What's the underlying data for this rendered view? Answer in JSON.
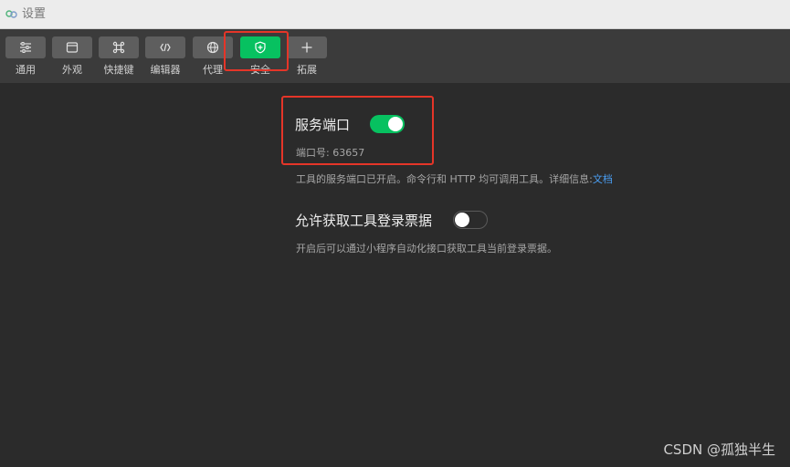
{
  "window": {
    "title": "设置"
  },
  "toolbar": {
    "items": [
      {
        "label": "通用",
        "icon": "sliders-icon",
        "active": false
      },
      {
        "label": "外观",
        "icon": "window-icon",
        "active": false
      },
      {
        "label": "快捷键",
        "icon": "command-key-icon",
        "active": false
      },
      {
        "label": "编辑器",
        "icon": "code-brackets-icon",
        "active": false
      },
      {
        "label": "代理",
        "icon": "globe-icon",
        "active": false
      },
      {
        "label": "安全",
        "icon": "shield-icon",
        "active": true
      },
      {
        "label": "拓展",
        "icon": "plus-icon",
        "active": false
      }
    ]
  },
  "security": {
    "service_port": {
      "title": "服务端口",
      "enabled": true,
      "port_label": "端口号:",
      "port_value": "63657",
      "description": "工具的服务端口已开启。命令行和 HTTP 均可调用工具。详细信息:",
      "doc_link": "文档"
    },
    "login_ticket": {
      "title": "允许获取工具登录票据",
      "enabled": false,
      "description": "开启后可以通过小程序自动化接口获取工具当前登录票据。"
    }
  },
  "watermark": "CSDN @孤独半生",
  "colors": {
    "accent": "#07c160",
    "highlight": "#e53528",
    "link": "#4a9ff5",
    "background": "#2b2b2b",
    "toolbar": "#3b3b3b"
  }
}
